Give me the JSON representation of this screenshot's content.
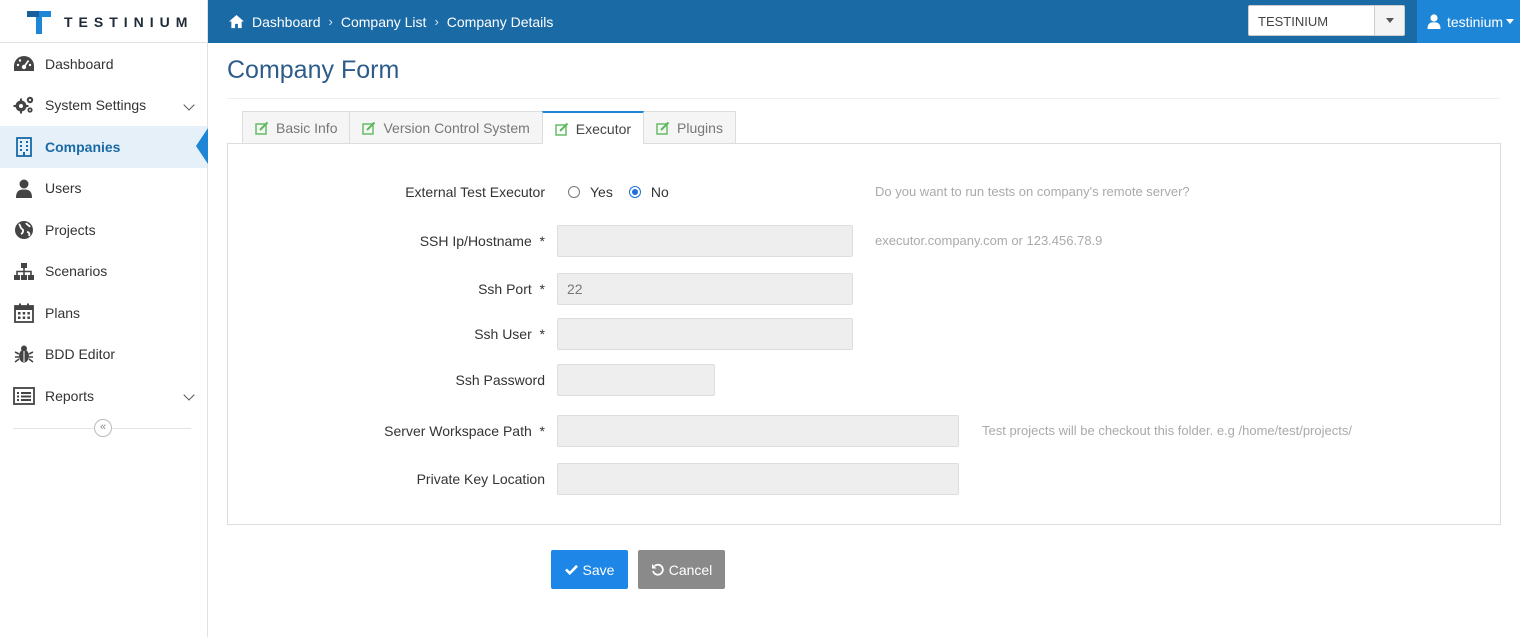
{
  "brand": {
    "logo_text": "TESTINIUM"
  },
  "breadcrumb": [
    "Dashboard",
    "Company List",
    "Company Details"
  ],
  "company_select": {
    "value": "TESTINIUM"
  },
  "user": {
    "name": "testinium"
  },
  "sidebar": {
    "items": [
      {
        "label": "Dashboard",
        "icon": "dashboard-icon"
      },
      {
        "label": "System Settings",
        "icon": "gears-icon",
        "expandable": true
      },
      {
        "label": "Companies",
        "icon": "building-icon",
        "active": true
      },
      {
        "label": "Users",
        "icon": "user-icon"
      },
      {
        "label": "Projects",
        "icon": "globe-icon"
      },
      {
        "label": "Scenarios",
        "icon": "sitemap-icon"
      },
      {
        "label": "Plans",
        "icon": "calendar-icon"
      },
      {
        "label": "BDD Editor",
        "icon": "bug-icon"
      },
      {
        "label": "Reports",
        "icon": "list-icon",
        "expandable": true
      }
    ],
    "collapse_glyph": "«"
  },
  "page": {
    "title": "Company Form"
  },
  "tabs": [
    {
      "label": "Basic Info"
    },
    {
      "label": "Version Control System"
    },
    {
      "label": "Executor",
      "active": true
    },
    {
      "label": "Plugins"
    }
  ],
  "form": {
    "external_executor": {
      "label": "External Test Executor",
      "options": [
        "Yes",
        "No"
      ],
      "selected": "No",
      "hint": "Do you want to run tests on company's remote server?"
    },
    "ssh_host": {
      "label": "SSH Ip/Hostname",
      "required": "*",
      "value": "",
      "hint": "executor.company.com or 123.456.78.9"
    },
    "ssh_port": {
      "label": "Ssh Port",
      "required": "*",
      "value": "22"
    },
    "ssh_user": {
      "label": "Ssh User",
      "required": "*",
      "value": ""
    },
    "ssh_password": {
      "label": "Ssh Password",
      "value": ""
    },
    "workspace_path": {
      "label": "Server Workspace Path",
      "required": "*",
      "value": "",
      "hint": "Test projects will be checkout this folder. e.g /home/test/projects/"
    },
    "private_key": {
      "label": "Private Key Location",
      "value": ""
    }
  },
  "actions": {
    "save_label": "Save",
    "cancel_label": "Cancel"
  },
  "colors": {
    "topbar": "#1a6aa6",
    "user_box": "#1e86d6",
    "save": "#1e86e6",
    "cancel": "#8a8a8a",
    "tab_icon": "#5cb85c"
  }
}
